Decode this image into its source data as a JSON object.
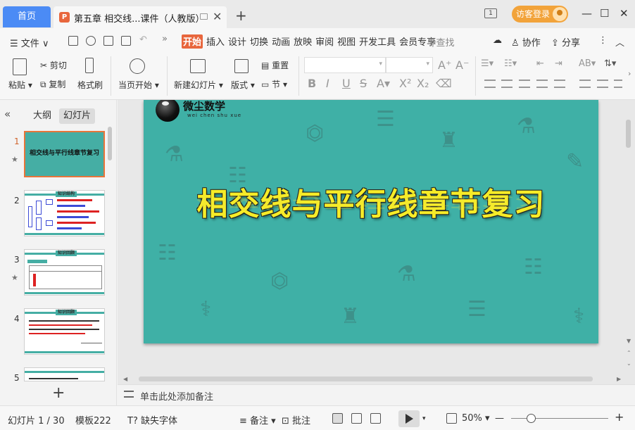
{
  "titlebar": {
    "home_tab": "首页",
    "doc_icon": "P",
    "doc_title": "第五章 相交线...课件（人教版）",
    "new_tab": "+",
    "guest_login": "访客登录",
    "minimize": "—",
    "maximize": "☐",
    "close": "✕"
  },
  "menubar": {
    "file": "文件",
    "tabs": [
      "开始",
      "插入",
      "设计",
      "切换",
      "动画",
      "放映",
      "审阅",
      "视图",
      "开发工具",
      "会员专享"
    ],
    "active_tab": "开始",
    "search": "查找",
    "collab": "协作",
    "share": "分享"
  },
  "ribbon": {
    "paste": "粘贴",
    "cut": "剪切",
    "copy": "复制",
    "format_painter": "格式刷",
    "start_from_current": "当页开始",
    "new_slide": "新建幻灯片",
    "layout": "版式",
    "section": "节",
    "reset": "重置",
    "font_name": "",
    "font_size": ""
  },
  "leftpanel": {
    "tab_outline": "大纲",
    "tab_slides": "幻灯片",
    "slides": [
      {
        "num": "1",
        "title": "相交线与平行线章节复习",
        "starred": true
      },
      {
        "num": "2",
        "title": "知识结构",
        "starred": false
      },
      {
        "num": "3",
        "title": "知识回顾",
        "starred": true
      },
      {
        "num": "4",
        "title": "知识回顾",
        "starred": false
      },
      {
        "num": "5",
        "title": "",
        "starred": false
      }
    ]
  },
  "slide": {
    "logo_text": "微尘数学",
    "logo_sub": "wei chen shu xue",
    "title": "相交线与平行线章节复习"
  },
  "notes": {
    "placeholder": "单击此处添加备注"
  },
  "statusbar": {
    "slide_index": "幻灯片 1 / 30",
    "template": "模板222",
    "missing_font": "缺失字体",
    "notes": "备注",
    "comments": "批注",
    "zoom": "50%",
    "zoom_level": 0.2
  }
}
